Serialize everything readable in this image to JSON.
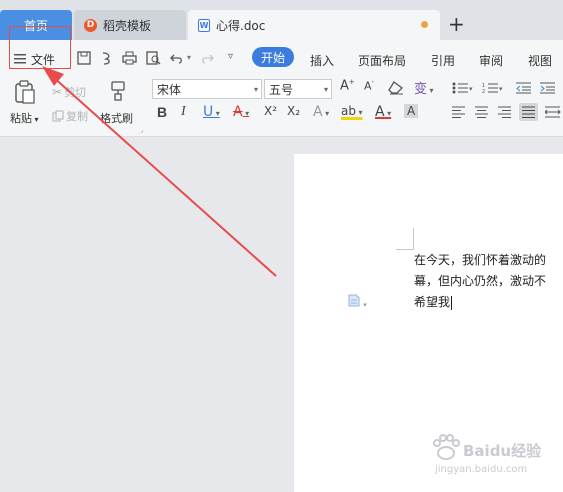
{
  "tabs": {
    "home": "首页",
    "template": "稻壳模板",
    "template_logo": "D",
    "doc": "心得.doc",
    "doc_logo": "W",
    "new_tab": "+"
  },
  "menubar": {
    "file": "文件",
    "items": [
      "开始",
      "插入",
      "页面布局",
      "引用",
      "审阅",
      "视图"
    ]
  },
  "ribbon": {
    "paste": "粘贴",
    "cut": "剪切",
    "copy": "复制",
    "format_painter": "格式刷",
    "font_name": "宋体",
    "font_size": "五号",
    "bold": "B",
    "italic": "I",
    "underline": "U",
    "strikethrough": "A",
    "superscript": "X²",
    "subscript": "X₂",
    "text_effect": "A",
    "highlight": "ab",
    "font_color": "A",
    "char_shading": "A",
    "grow_font": "A",
    "shrink_font": "A",
    "phonetic": "变"
  },
  "document": {
    "lines": [
      "在今天，我们怀着激动的",
      "幕，但内心仍然，激动不",
      "希望我"
    ]
  },
  "watermark": {
    "brand": "Baidu经验",
    "url": "jingyan.baidu.com"
  },
  "colors": {
    "accent": "#3b7ddd",
    "home_tab": "#4a8fe2",
    "annotation": "#e74c4c"
  }
}
